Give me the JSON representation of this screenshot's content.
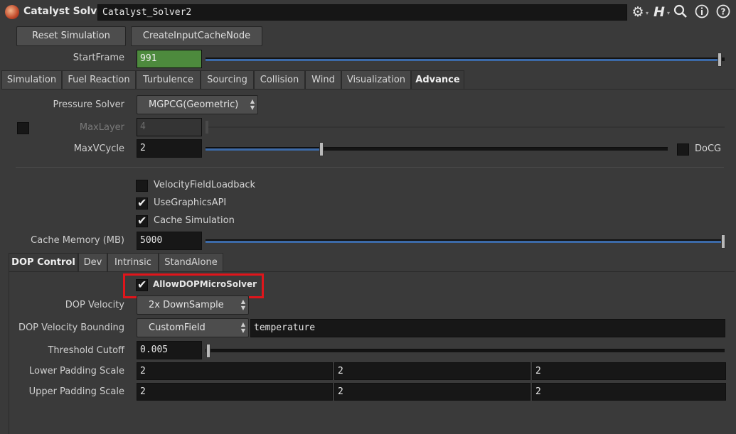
{
  "header": {
    "title": "Catalyst Solver",
    "node_name": "Catalyst_Solver2",
    "icons": [
      "gear-icon",
      "houdini-help-icon",
      "search-icon",
      "info-icon",
      "help-icon"
    ]
  },
  "buttons": {
    "reset": "Reset Simulation",
    "create_cache": "CreateInputCacheNode"
  },
  "start_frame": {
    "label": "StartFrame",
    "value": "991",
    "slider_fraction": 1.0
  },
  "tabs": [
    "Simulation",
    "Fuel Reaction",
    "Turbulence",
    "Sourcing",
    "Collision",
    "Wind",
    "Visualization",
    "Advance"
  ],
  "active_tab": "Advance",
  "advance": {
    "pressure_solver": {
      "label": "Pressure Solver",
      "value": "MGPCG(Geometric)"
    },
    "max_layer": {
      "label": "MaxLayer",
      "value": "4",
      "enabled": false
    },
    "max_vcycle": {
      "label": "MaxVCycle",
      "value": "2",
      "slider_fraction": 0.25
    },
    "docg": {
      "label": "DoCG",
      "checked": false
    },
    "velocity_field_loadback": {
      "label": "VelocityFieldLoadback",
      "checked": false
    },
    "use_graphics_api": {
      "label": "UseGraphicsAPI",
      "checked": true
    },
    "cache_simulation": {
      "label": "Cache Simulation",
      "checked": true
    },
    "cache_memory": {
      "label": "Cache Memory (MB)",
      "value": "5000",
      "slider_fraction": 1.0
    }
  },
  "subtabs": [
    "DOP Control",
    "Dev",
    "Intrinsic",
    "StandAlone"
  ],
  "active_subtab": "DOP Control",
  "dop": {
    "allow_micro_solver": {
      "label": "AllowDOPMicroSolver",
      "checked": true
    },
    "dop_velocity": {
      "label": "DOP Velocity",
      "value": "2x DownSample"
    },
    "dop_velocity_bounding": {
      "label": "DOP Velocity Bounding",
      "value": "CustomField",
      "field": "temperature"
    },
    "threshold_cutoff": {
      "label": "Threshold Cutoff",
      "value": "0.005",
      "slider_fraction": 0.0
    },
    "lower_padding": {
      "label": "Lower Padding Scale",
      "values": [
        "2",
        "2",
        "2"
      ]
    },
    "upper_padding": {
      "label": "Upper Padding Scale",
      "values": [
        "2",
        "2",
        "2"
      ]
    }
  },
  "colors": {
    "accent": "#3c6aa8",
    "highlight": "#e0151b",
    "start_frame_bg": "#4d8a3d"
  }
}
